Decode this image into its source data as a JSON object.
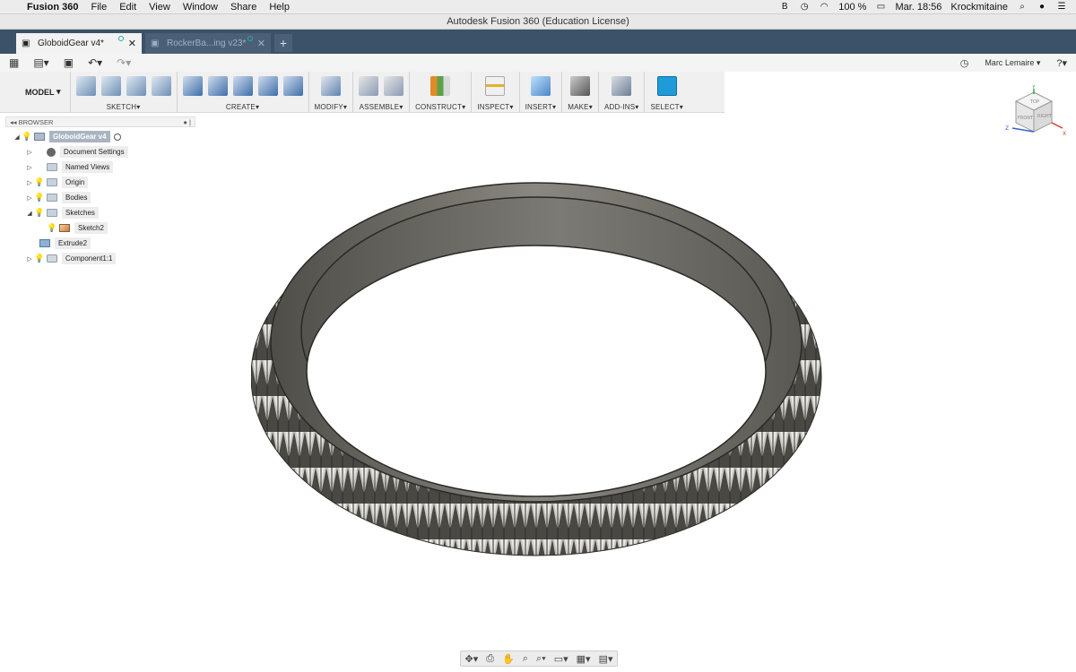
{
  "os_menubar": {
    "app_name": "Fusion 360",
    "menus": [
      "File",
      "Edit",
      "View",
      "Window",
      "Share",
      "Help"
    ],
    "battery": "100 %",
    "datetime": "Mar. 18:56",
    "user": "Krockmitaine"
  },
  "window": {
    "title": "Autodesk Fusion 360 (Education License)"
  },
  "tabs": [
    {
      "label": "GloboidGear v4*",
      "active": true
    },
    {
      "label": "RockerBa...ing v23*",
      "active": false
    }
  ],
  "quickbar": {
    "user_name": "Marc Lemaire"
  },
  "ribbon": {
    "workspace": "MODEL",
    "groups": [
      {
        "label": "SKETCH"
      },
      {
        "label": "CREATE"
      },
      {
        "label": "MODIFY"
      },
      {
        "label": "ASSEMBLE"
      },
      {
        "label": "CONSTRUCT"
      },
      {
        "label": "INSPECT"
      },
      {
        "label": "INSERT"
      },
      {
        "label": "MAKE"
      },
      {
        "label": "ADD-INS"
      },
      {
        "label": "SELECT"
      }
    ]
  },
  "browser": {
    "title": "BROWSER",
    "root": "GloboidGear v4",
    "items": [
      {
        "label": "Document Settings"
      },
      {
        "label": "Named Views"
      },
      {
        "label": "Origin"
      },
      {
        "label": "Bodies"
      },
      {
        "label": "Sketches"
      },
      {
        "label": "Sketch2"
      },
      {
        "label": "Extrude2"
      },
      {
        "label": "Component1:1"
      }
    ]
  },
  "viewcube": {
    "top": "TOP",
    "front": "FRONT",
    "right": "RIGHT",
    "axis_y": "Y",
    "axis_z": "Z",
    "axis_x": "X"
  },
  "colors": {
    "tab_bar": "#3c5269",
    "select_accent": "#1f9bd9",
    "gear_body": "#6e6b63"
  }
}
